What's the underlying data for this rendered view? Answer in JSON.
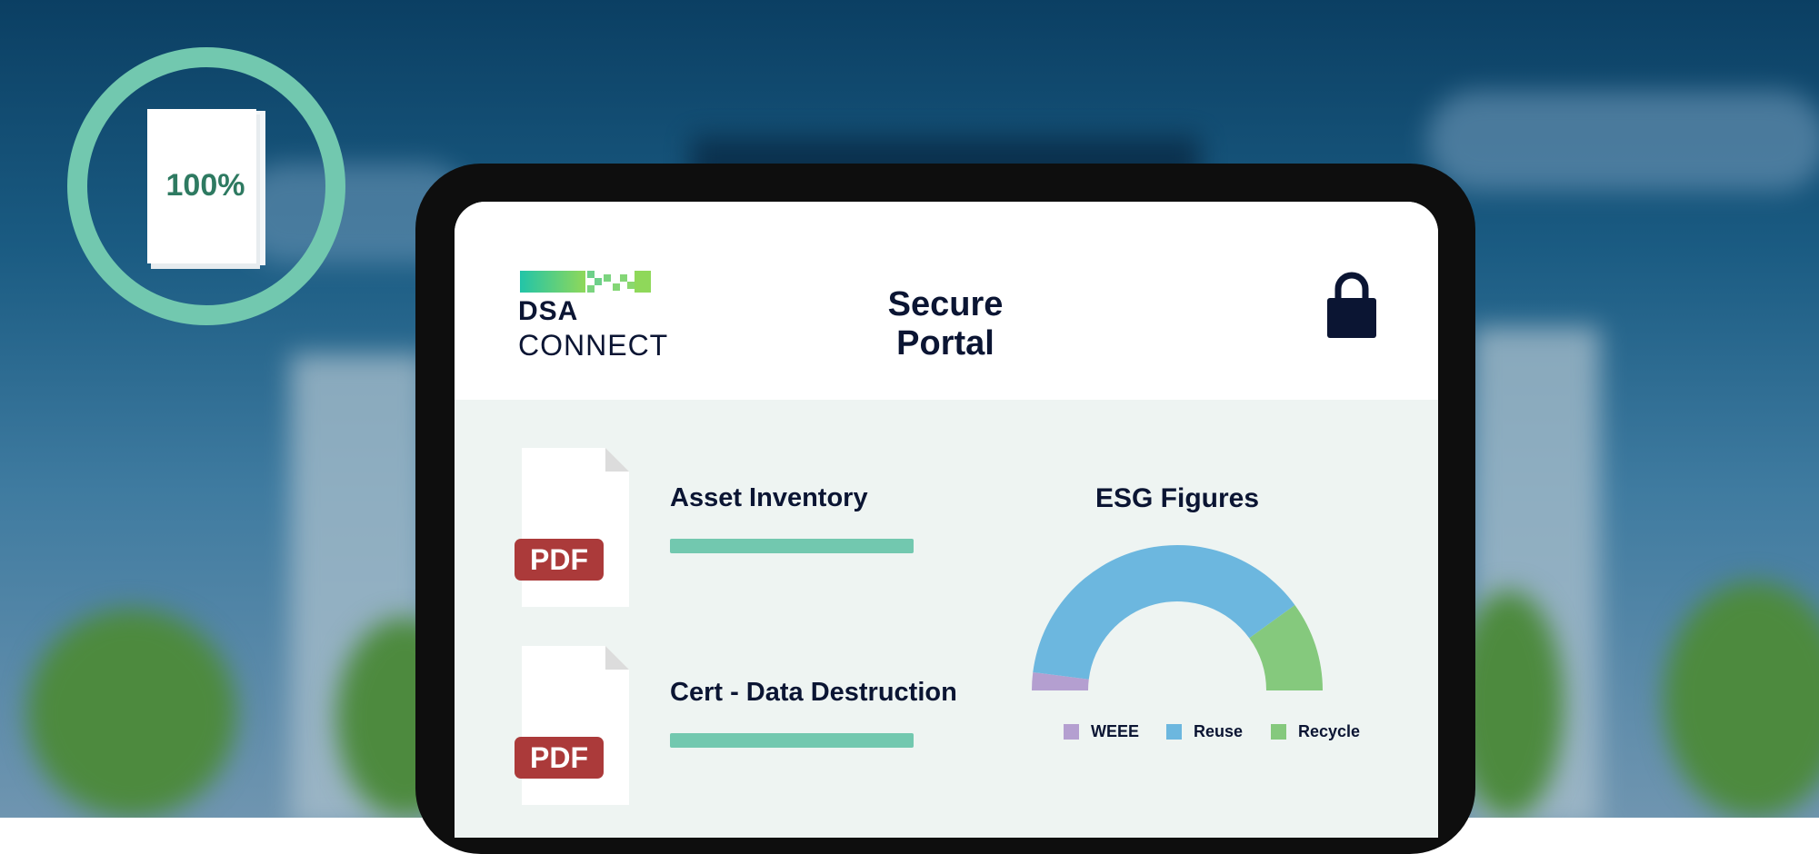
{
  "badge": {
    "percent_label": "100%"
  },
  "portal": {
    "brand_line1": "DSA",
    "brand_line2": "CONNECT",
    "title": "Secure Portal"
  },
  "documents": [
    {
      "file_type": "PDF",
      "title": "Asset Inventory"
    },
    {
      "file_type": "PDF",
      "title": "Cert - Data Destruction"
    }
  ],
  "esg": {
    "title": "ESG Figures"
  },
  "chart_data": {
    "type": "pie",
    "title": "ESG Figures",
    "style": "semi-donut",
    "categories": [
      "WEEE",
      "Reuse",
      "Recycle"
    ],
    "values": [
      4,
      76,
      20
    ],
    "colors": [
      "#b49fd0",
      "#6cb7df",
      "#85c97d"
    ],
    "legend": "bottom"
  },
  "colors": {
    "accent": "#72c8af",
    "navy": "#0b1533",
    "pdf_badge": "#ab3a3a",
    "tablet_frame": "#0e0e0e"
  },
  "icons": [
    "document-stack-icon",
    "lock-icon",
    "pdf-file-icon",
    "logo-icon"
  ]
}
